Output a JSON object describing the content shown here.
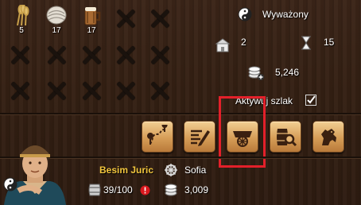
{
  "goods": [
    {
      "icon": "wheat-icon",
      "count": "5"
    },
    {
      "icon": "wool-icon",
      "count": "17"
    },
    {
      "icon": "beer-icon",
      "count": "17"
    }
  ],
  "stats": {
    "balance_label": "Wyważony",
    "warehouse_count": "2",
    "time_count": "15",
    "coins_value": "5,246"
  },
  "route": {
    "activate_label": "Aktywuj szlak",
    "checked": true
  },
  "actions": [
    {
      "name": "route-map-button",
      "icon": "map-route-icon"
    },
    {
      "name": "edit-route-button",
      "icon": "edit-list-icon"
    },
    {
      "name": "cart-button",
      "icon": "cart-icon"
    },
    {
      "name": "barrel-search-button",
      "icon": "barrel-search-icon"
    },
    {
      "name": "trade-button",
      "icon": "horse-icon"
    }
  ],
  "character": {
    "name": "Besim Juric",
    "city": "Sofia",
    "capacity": "39/100",
    "money": "3,009"
  },
  "colors": {
    "name": "#f2c53d",
    "highlight": "#e3202a",
    "warning": "#d8181e"
  }
}
